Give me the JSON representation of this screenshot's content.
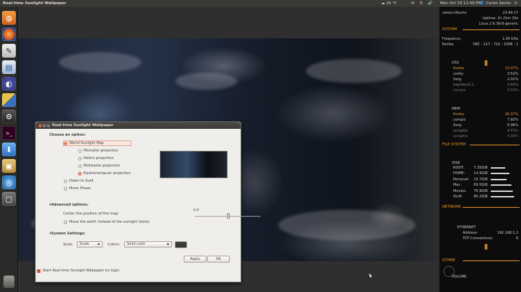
{
  "top_panel": {
    "window_title": "Real-time Sunlight Wallpaper",
    "weather": "16 °C",
    "clock": "Mon Oct 10 11:49 PM",
    "user": "Carles Sentís"
  },
  "launcher": {
    "items": [
      "home-folder",
      "firefox",
      "text-editor",
      "libreoffice-writer",
      "eclipse",
      "workspaces",
      "system-settings",
      "terminal",
      "download-manager",
      "package-installer",
      "network-browser",
      "screenshot"
    ],
    "trash": "trash"
  },
  "dialog": {
    "title": "Real-time Sunlight Wallpaper",
    "choose_label": "Choose an option:",
    "options": {
      "world": "World Sunlight Map",
      "mercator": "Mercator projection",
      "peters": "Peters projection",
      "mollweide": "Mollweide projection",
      "equirect": "Equirectangular projection",
      "dawn": "Dawn to dusk",
      "moon": "Moon Phase"
    },
    "advanced_label": "Advanced options:",
    "center_label": "Center the position of the map:",
    "slider_value": "0.0",
    "move_earth": "Move the earth instead of the sunlight (beta)",
    "system_label": "System Settings:",
    "style_label": "Style:",
    "style_value": "Scale",
    "colors_label": "Colors:",
    "colors_value": "Solid color",
    "apply": "Apply",
    "ok": "OK",
    "startup": "Start Real-time Sunlight Wallpaper on login"
  },
  "conky": {
    "host": "carles-Ubuntu",
    "time": "23:49:17",
    "uptime": "Uptime: 1h 21m 32s",
    "kernel": "Linux 2.6.38-8-generic",
    "system_head": "SYSTEM",
    "frequency_label": "Frequency:",
    "frequency_value": "1.00 GHz",
    "nvidia_label": "Nvidia:",
    "nvidia_value": "58C - 127 - 710 - 1008 - 1",
    "cpu_label": "CPU",
    "cpu_procs": [
      {
        "name": "firefox",
        "value": "13.07%"
      },
      {
        "name": "conky",
        "value": "3.52%"
      },
      {
        "name": "Xorg",
        "value": "2.01%"
      },
      {
        "name": "kworker/1:2",
        "value": "0.50%"
      },
      {
        "name": "compiz",
        "value": "0.50%"
      }
    ],
    "mem_label": "MEM",
    "mem_procs": [
      {
        "name": "firefox",
        "value": "26.37%"
      },
      {
        "name": "compiz",
        "value": "7.92%"
      },
      {
        "name": "Xorg",
        "value": "5.06%"
      },
      {
        "name": "synaptic",
        "value": "4.71%"
      },
      {
        "name": "synaptic",
        "value": "4.39%"
      }
    ],
    "fs_head": "FILE SYSTEM",
    "disk_label": "DISK",
    "disks": [
      {
        "name": "ROOT:",
        "value": "7.35GiB",
        "usage": 0.55
      },
      {
        "name": "HOME:",
        "value": "14.9GiB",
        "usage": 0.7
      },
      {
        "name": "Personal:",
        "value": "16.7GiB",
        "usage": 0.6
      },
      {
        "name": "Mac:",
        "value": "69.5GiB",
        "usage": 0.8
      },
      {
        "name": "Movies:",
        "value": "76.9GiB",
        "usage": 0.85
      },
      {
        "name": "Stuff:",
        "value": "85.2GiB",
        "usage": 0.9
      }
    ],
    "network_head": "NETWORK",
    "ethernet_label": "ETHERNET",
    "address_label": "Address:",
    "address_value": "192.168.1.2",
    "tcp_label": "TCP Connections:",
    "tcp_value": "8",
    "other_head": "OTHER",
    "volume_label": "VOLUME"
  },
  "colors": {
    "accent": "#ef9a2a",
    "ubuntu_orange": "#e0582a",
    "panel": "#3a3935"
  }
}
